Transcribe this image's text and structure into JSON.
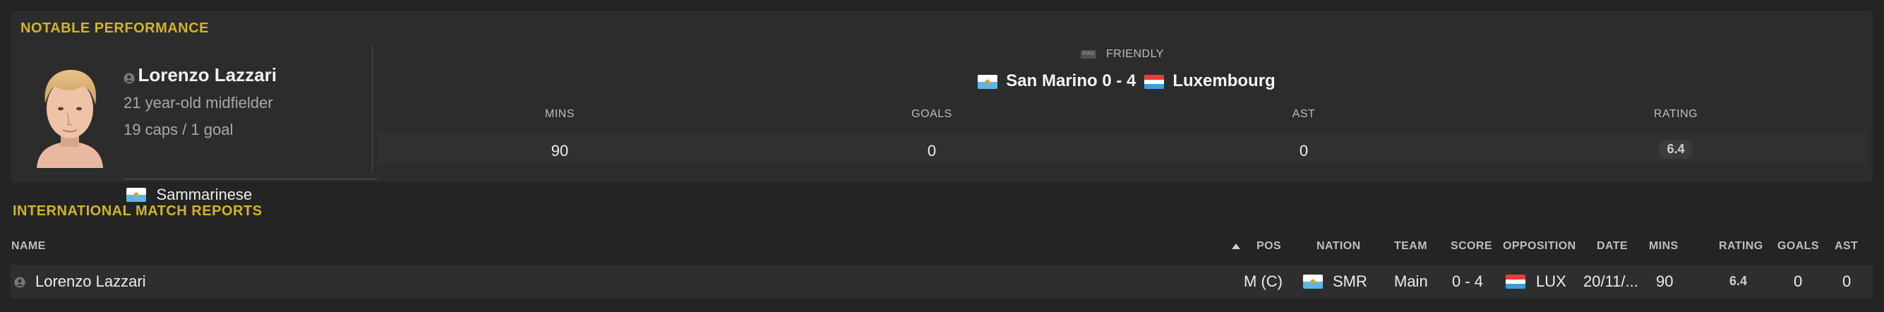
{
  "notable": {
    "title": "NOTABLE PERFORMANCE",
    "player": {
      "name": "Lorenzo Lazzari",
      "description": "21 year-old midfielder",
      "caps": "19 caps / 1 goal",
      "nationality": "Sammarinese"
    },
    "match": {
      "competition": "FRIENDLY",
      "home_team": "San Marino",
      "score": "0 - 4",
      "away_team": "Luxembourg"
    },
    "stats": {
      "mins_label": "MINS",
      "goals_label": "GOALS",
      "ast_label": "AST",
      "rating_label": "RATING",
      "mins": "90",
      "goals": "0",
      "ast": "0",
      "rating": "6.4"
    }
  },
  "reports": {
    "title": "INTERNATIONAL MATCH REPORTS",
    "columns": {
      "name": "NAME",
      "pos": "POS",
      "nation": "NATION",
      "team": "TEAM",
      "score": "SCORE",
      "opposition": "OPPOSITION",
      "date": "DATE",
      "mins": "MINS",
      "rating": "RATING",
      "goals": "GOALS",
      "ast": "AST"
    },
    "rows": [
      {
        "name": "Lorenzo Lazzari",
        "pos": "M (C)",
        "nation": "SMR",
        "team": "Main",
        "score": "0 - 4",
        "opposition": "LUX",
        "date": "20/11/...",
        "mins": "90",
        "rating": "6.4",
        "goals": "0",
        "ast": "0"
      }
    ]
  },
  "colors": {
    "accent_gold": "#d4b32a",
    "background": "#242424",
    "panel": "#2c2c2c"
  },
  "icons": [
    "person-icon",
    "san-marino-flag-icon",
    "luxembourg-flag-icon",
    "fifa-logo-icon",
    "sort-ascending-icon"
  ]
}
